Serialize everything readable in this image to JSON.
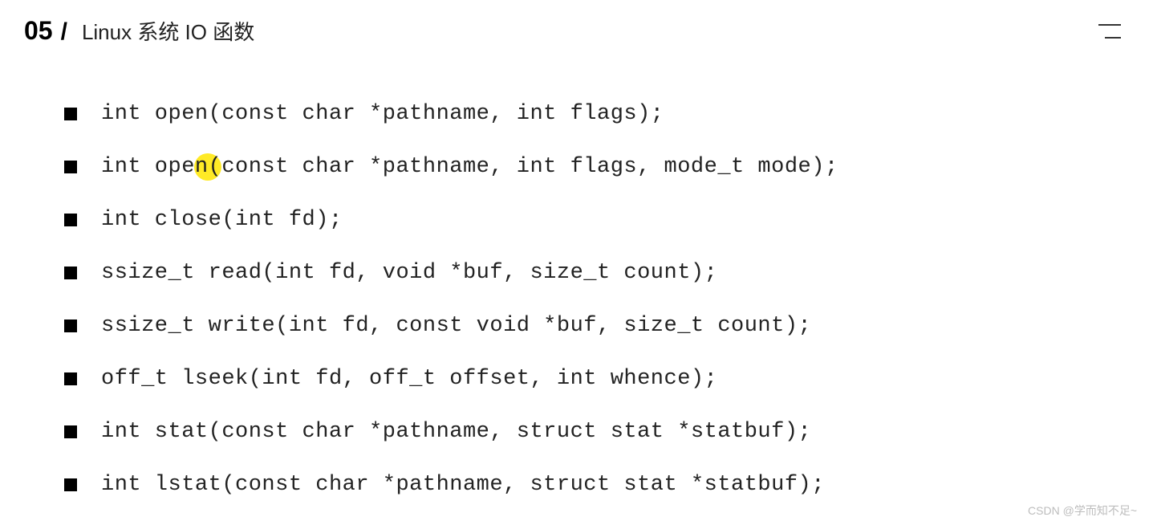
{
  "header": {
    "number": "05",
    "slash": "/",
    "title": "Linux 系统 IO 函数"
  },
  "functions": [
    "int open(const char *pathname, int flags);",
    "int open(const char *pathname, int flags, mode_t mode);",
    "int close(int fd);",
    "ssize_t read(int fd, void *buf, size_t count);",
    "ssize_t write(int fd, const void *buf, size_t count);",
    "off_t lseek(int fd, off_t offset, int whence);",
    "int stat(const char *pathname, struct stat *statbuf);",
    "int lstat(const char *pathname, struct stat *statbuf);"
  ],
  "cursor": {
    "highlighted_index": 1
  },
  "watermark": "CSDN @学而知不足~"
}
